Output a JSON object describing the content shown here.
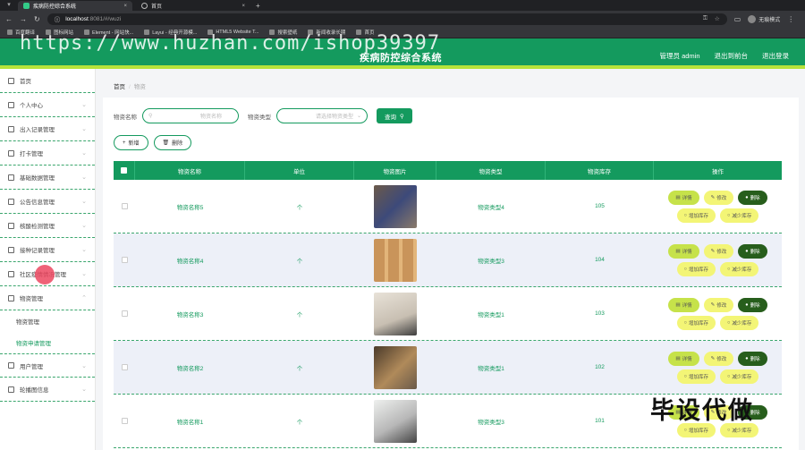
{
  "browser": {
    "tabs": [
      {
        "label": "疾病防控综合系统",
        "active": true
      },
      {
        "label": "首页",
        "active": false
      }
    ],
    "url": {
      "host": "localhost",
      "rest": ":8081/#/wuzi"
    },
    "profile_label": "无痕模式",
    "bookmarks": [
      "百度翻译",
      "图标网站",
      "Element - 网站快...",
      "Layui - 经典开源模...",
      "HTML5 Website T...",
      "搜索壁纸",
      "新闻收录长期",
      "首页"
    ]
  },
  "header": {
    "title": "疾病防控综合系统",
    "links": [
      "管理员 admin",
      "退出到前台",
      "退出登录"
    ]
  },
  "watermarks": {
    "url": "https://www.huzhan.com/ishop39397",
    "corner": "毕设代做"
  },
  "sidebar": {
    "items": [
      {
        "label": "首页",
        "chevron": false
      },
      {
        "label": "个人中心",
        "chevron": true
      },
      {
        "label": "出入记录管理",
        "chevron": true
      },
      {
        "label": "打卡管理",
        "chevron": true
      },
      {
        "label": "基础数据管理",
        "chevron": true
      },
      {
        "label": "公告信息管理",
        "chevron": true
      },
      {
        "label": "核酸检测管理",
        "chevron": true
      },
      {
        "label": "接种记录管理",
        "chevron": true
      },
      {
        "label": "社区疫情情况管理",
        "chevron": true
      },
      {
        "label": "物资管理",
        "chevron": true
      }
    ],
    "sub_items": [
      {
        "label": "物资管理",
        "active": false
      },
      {
        "label": "物资申请管理",
        "active": true
      }
    ],
    "items_after": [
      {
        "label": "用户管理",
        "chevron": true
      },
      {
        "label": "轮播图信息",
        "chevron": true
      }
    ]
  },
  "breadcrumb": {
    "home": "首页",
    "current": "物资"
  },
  "search": {
    "name_label": "物资名称",
    "name_placeholder": "物资名称",
    "type_label": "物资类型",
    "type_placeholder": "请选择物资类型",
    "search_button": "查询"
  },
  "actions": {
    "add": "新增",
    "delete": "删除"
  },
  "table": {
    "headers": [
      "物资名称",
      "单位",
      "物资图片",
      "物资类型",
      "物资库存",
      "操作"
    ],
    "rows": [
      {
        "name": "物资名称5",
        "unit": "个",
        "type": "物资类型4",
        "stock": "105"
      },
      {
        "name": "物资名称4",
        "unit": "个",
        "type": "物资类型3",
        "stock": "104"
      },
      {
        "name": "物资名称3",
        "unit": "个",
        "type": "物资类型1",
        "stock": "103"
      },
      {
        "name": "物资名称2",
        "unit": "个",
        "type": "物资类型1",
        "stock": "102"
      },
      {
        "name": "物资名称1",
        "unit": "个",
        "type": "物资类型3",
        "stock": "101"
      }
    ],
    "row_actions": {
      "detail": "详情",
      "edit": "修改",
      "delete": "删除",
      "add_stock": "增加库存",
      "reduce_stock": "减少库存"
    }
  }
}
